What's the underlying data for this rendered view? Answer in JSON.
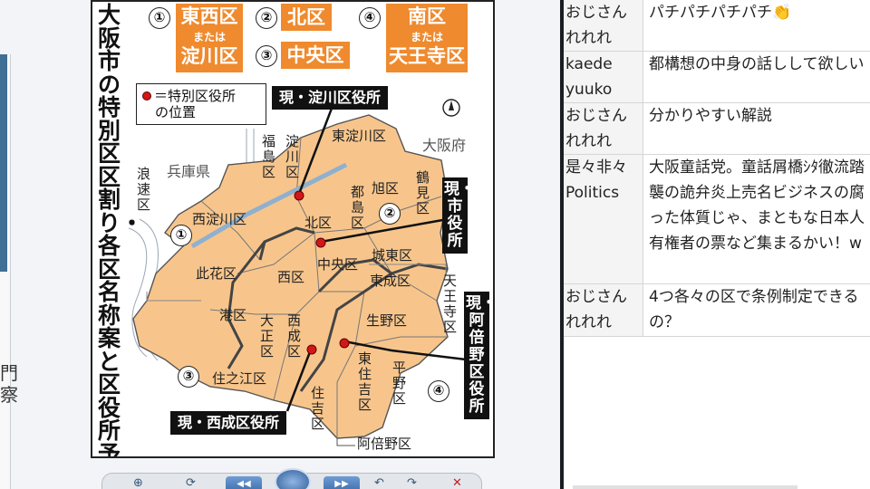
{
  "map": {
    "title": "大阪市の特別区区割り・各区名称案と区役所予定地",
    "ward_options": [
      {
        "number": "①",
        "name": "東西区",
        "alt_text": "または",
        "alt_name": "淀川区"
      },
      {
        "number": "②",
        "name": "北区"
      },
      {
        "number": "③",
        "name": "中央区"
      },
      {
        "number": "④",
        "name": "南区",
        "alt_text": "または",
        "alt_name": "天王寺区"
      }
    ],
    "legend": {
      "line1": "＝特別区役所",
      "line2": "の位置"
    },
    "offices": {
      "yodogawa": "現・淀川区役所",
      "city_hall": "現・市役所",
      "abeno": "現・阿倍野区役所",
      "nishinari": "現・西成区役所"
    },
    "regions": {
      "hyogo": "兵庫県",
      "osaka_pref": "大阪府"
    },
    "north_symbol": "N",
    "areas": {
      "higashiyodogawa": "東淀川区",
      "fukushima": "福島区",
      "yodogawa": "淀川区",
      "naniwa": "浪速区",
      "nishiyodogawa": "西淀川区",
      "miyakojima": "都島区",
      "asahi": "旭区",
      "tsurumi": "鶴見区",
      "kita": "北区",
      "joto": "城東区",
      "konohana": "此花区",
      "chuo": "中央区",
      "nishi": "西区",
      "higashinari": "東成区",
      "tennoji": "天王寺区",
      "minato": "港区",
      "taisho": "大正区",
      "nishinari": "西成区",
      "ikuno": "生野区",
      "higashisumiyoshi": "東住吉区",
      "hirano": "平野区",
      "suminoe": "住之江区",
      "sumiyoshi": "住吉区",
      "abeno": "阿倍野区"
    },
    "area_numbers": {
      "n1": "①",
      "n2": "②",
      "n3": "③",
      "n4": "④"
    }
  },
  "chat": [
    {
      "name": "おじさんれれれ",
      "message": "パチパチパチパチ👏"
    },
    {
      "name": "kaede yuuko",
      "message": "都構想の中身の話しして欲しい"
    },
    {
      "name": "おじさんれれれ",
      "message": "分かりやすい解説"
    },
    {
      "name": "是々非々 Politics",
      "message": "大阪童話党。童話屑橋ｼﾀ徹流踏襲の詭弁炎上売名ビジネスの腐った体質じゃ、まともな日本人有権者の票など集まるかい！w"
    },
    {
      "name": "おじさんれれれ",
      "message": "4つ各々の区で条例制定できるの？"
    }
  ],
  "toolbar": {
    "close_glyph": "✕"
  },
  "colors": {
    "ward_orange": "#ef8a2e",
    "map_fill": "#f7c58c",
    "office_dot": "#d01818"
  }
}
